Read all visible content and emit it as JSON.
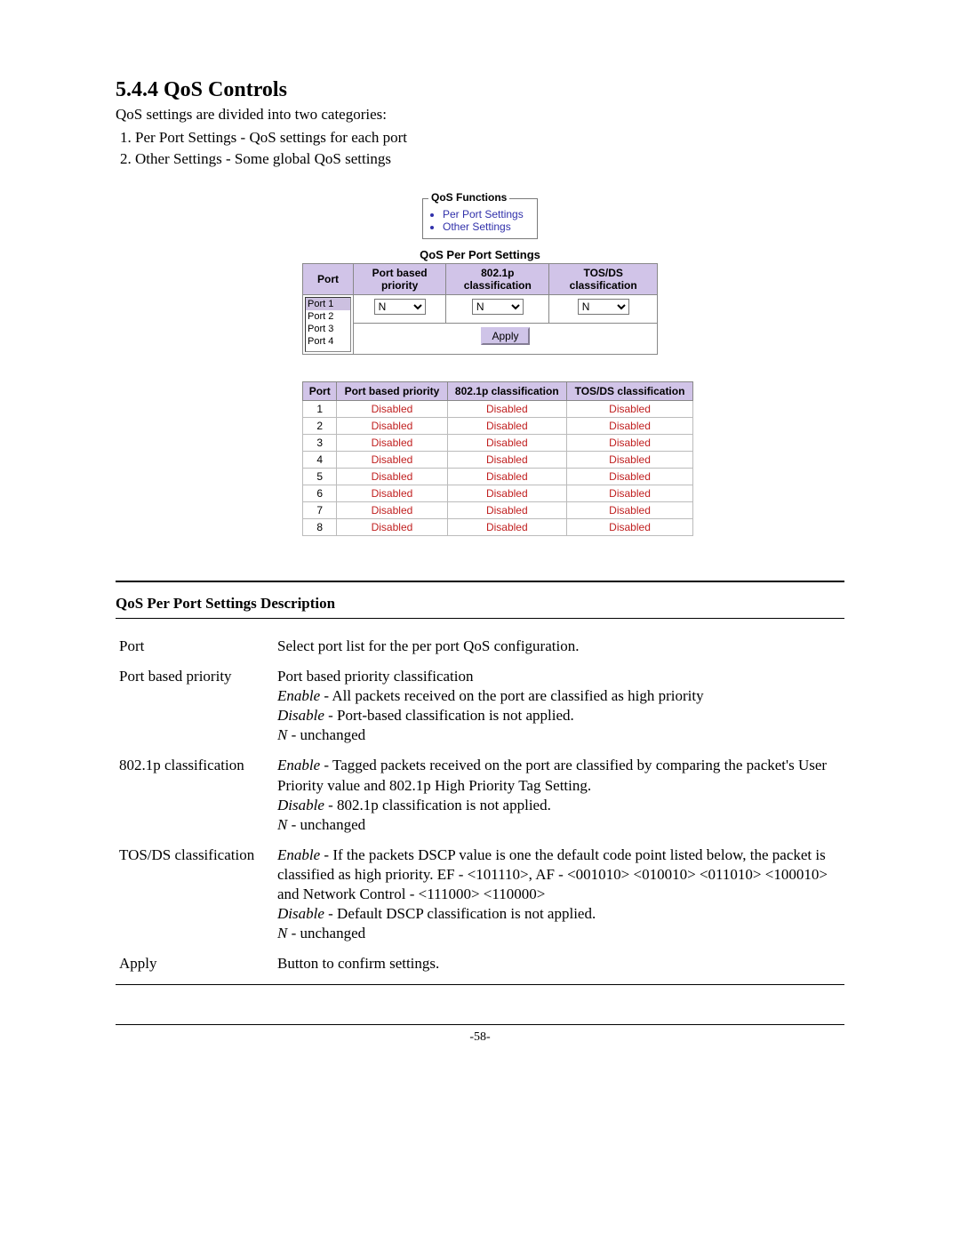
{
  "section": {
    "number": "5.4.4",
    "title": "QoS Controls",
    "intro": "QoS settings are divided into two categories:",
    "list": [
      "Per Port Settings - QoS settings for each port",
      "Other Settings - Some global QoS settings"
    ]
  },
  "functions_box": {
    "legend": "QoS Functions",
    "items": [
      "Per Port Settings",
      "Other Settings"
    ]
  },
  "per_port_panel": {
    "heading": "QoS Per Port Settings",
    "columns": [
      "Port",
      "Port based priority",
      "802.1p classification",
      "TOS/DS classification"
    ],
    "port_options": [
      "Port 1",
      "Port 2",
      "Port 3",
      "Port 4"
    ],
    "selected_port": "Port 1",
    "dropdowns": {
      "port_priority": "N",
      "p8021": "N",
      "tosds": "N"
    },
    "apply_label": "Apply"
  },
  "status_table": {
    "columns": [
      "Port",
      "Port based priority",
      "802.1p classification",
      "TOS/DS classification"
    ],
    "rows": [
      {
        "port": "1",
        "pbp": "Disabled",
        "p8021": "Disabled",
        "tosds": "Disabled"
      },
      {
        "port": "2",
        "pbp": "Disabled",
        "p8021": "Disabled",
        "tosds": "Disabled"
      },
      {
        "port": "3",
        "pbp": "Disabled",
        "p8021": "Disabled",
        "tosds": "Disabled"
      },
      {
        "port": "4",
        "pbp": "Disabled",
        "p8021": "Disabled",
        "tosds": "Disabled"
      },
      {
        "port": "5",
        "pbp": "Disabled",
        "p8021": "Disabled",
        "tosds": "Disabled"
      },
      {
        "port": "6",
        "pbp": "Disabled",
        "p8021": "Disabled",
        "tosds": "Disabled"
      },
      {
        "port": "7",
        "pbp": "Disabled",
        "p8021": "Disabled",
        "tosds": "Disabled"
      },
      {
        "port": "8",
        "pbp": "Disabled",
        "p8021": "Disabled",
        "tosds": "Disabled"
      }
    ]
  },
  "description": {
    "heading": "QoS Per Port Settings Description",
    "items": {
      "port": {
        "term": "Port",
        "body": "Select port list for the per port QoS configuration."
      },
      "pbp": {
        "term": "Port based priority",
        "line1": "Port based priority classification",
        "enable": " - All packets received on the port are classified as high priority",
        "disable": " - Port-based classification is not applied.",
        "n": " - unchanged"
      },
      "p8021": {
        "term": "802.1p classification",
        "enable": " - Tagged packets received on the port are classified by comparing the packet's User Priority value and 802.1p High Priority Tag Setting.",
        "disable": " - 802.1p classification is not applied.",
        "n": " - unchanged"
      },
      "tosds": {
        "term": "TOS/DS classification",
        "enable": " - If the packets DSCP value is one the default code point listed below, the packet is classified as high priority. EF - <101110>, AF - <001010> <010010> <011010> <100010> and Network Control - <111000> <110000>",
        "disable": " - Default DSCP classification is not applied.",
        "n": " - unchanged"
      },
      "apply": {
        "term": "Apply",
        "body": "Button to confirm settings."
      }
    },
    "labels": {
      "enable": "Enable",
      "disable": "Disable",
      "n": "N"
    }
  },
  "page_number": "-58-"
}
